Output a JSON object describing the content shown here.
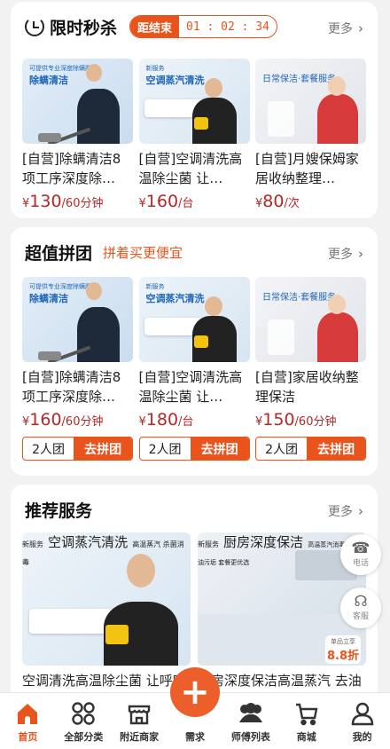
{
  "flash_sale": {
    "title": "限时秒杀",
    "countdown_label": "距结束",
    "countdown_time": "01 : 02 : 34",
    "more": "更多",
    "items": [
      {
        "name": "[自营]除螨清洁8项工序深度除…",
        "currency": "¥",
        "price": "130",
        "unit": "/60分钟",
        "thumb_tag": "除螨清洁",
        "thumb_small": "可提供专业深度除螨服务"
      },
      {
        "name": "[自营]空调清洗高温除尘菌 让…",
        "currency": "¥",
        "price": "160",
        "unit": "/台",
        "thumb_tag": "空调蒸汽清洗",
        "thumb_small": "新服务"
      },
      {
        "name": "[自营]月嫂保姆家居收纳整理…",
        "currency": "¥",
        "price": "80",
        "unit": "/次",
        "thumb_tag": "日常保洁·套餐服务",
        "thumb_small": ""
      }
    ]
  },
  "group_buy": {
    "title": "超值拼团",
    "subtitle": "拼着买更便宜",
    "more": "更多",
    "items": [
      {
        "name": "[自营]除螨清洁8项工序深度除…",
        "currency": "¥",
        "price": "160",
        "unit": "/60分钟",
        "team": "2人团",
        "go": "去拼团",
        "thumb_tag": "除螨清洁",
        "thumb_small": "可提供专业深度除螨服务"
      },
      {
        "name": "[自营]空调清洗高温除尘菌 让…",
        "currency": "¥",
        "price": "180",
        "unit": "/台",
        "team": "2人团",
        "go": "去拼团",
        "thumb_tag": "空调蒸汽清洗",
        "thumb_small": "新服务"
      },
      {
        "name": "[自营]家居收纳整理保洁",
        "currency": "¥",
        "price": "150",
        "unit": "/60分钟",
        "team": "2人团",
        "go": "去拼团",
        "thumb_tag": "日常保洁·套餐服务",
        "thumb_small": ""
      }
    ]
  },
  "recommend": {
    "title": "推荐服务",
    "more": "更多",
    "items": [
      {
        "name": "空调清洗高温除尘菌 让呼吸更清新 让感觉更舒适",
        "thumb_tag": "空调蒸汽清洗",
        "thumb_pill": "高温蒸汽 杀菌消毒",
        "thumb_small": "新服务"
      },
      {
        "name": "厨房深度保洁高温蒸汽 去油污去霉菌",
        "thumb_tag": "厨房深度保洁",
        "thumb_pill": "高温蒸汽消毒 强效去油污垢 套餐更优选",
        "thumb_small": "新服务",
        "price_badge_label": "单品立享",
        "price_badge": "8.8折"
      }
    ]
  },
  "floating": {
    "phone": "电话",
    "service": "客服"
  },
  "tabbar": {
    "items": [
      {
        "label": "首页",
        "icon": "home-icon",
        "active": true
      },
      {
        "label": "全部分类",
        "icon": "grid-icon"
      },
      {
        "label": "附近商家",
        "icon": "store-icon"
      },
      {
        "label": "需求",
        "icon": "plus-icon"
      },
      {
        "label": "师傅列表",
        "icon": "people-icon"
      },
      {
        "label": "商城",
        "icon": "cart-icon"
      },
      {
        "label": "我的",
        "icon": "user-icon"
      }
    ]
  },
  "colors": {
    "accent": "#e8541c",
    "price": "#b72727",
    "background": "#f2f2f2"
  }
}
